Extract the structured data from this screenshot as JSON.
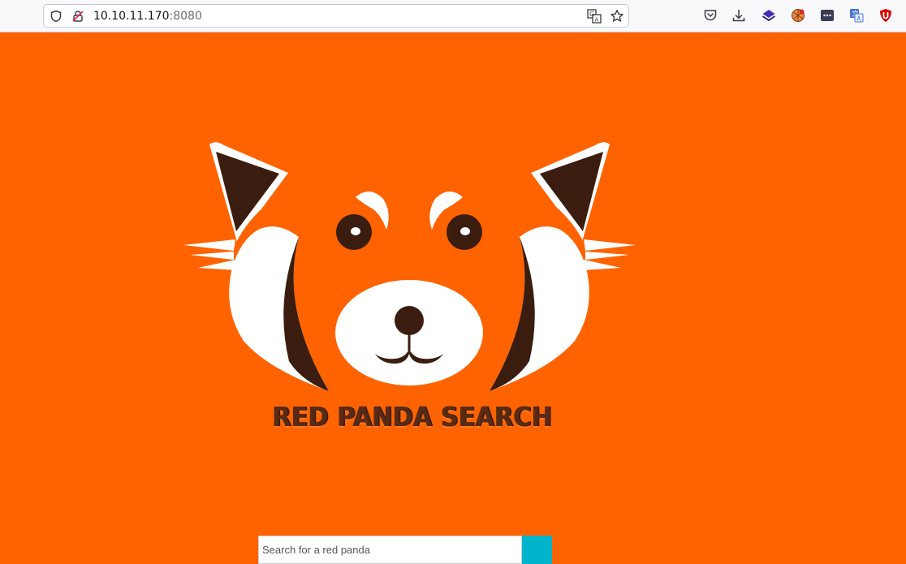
{
  "browser": {
    "url_host": "10.10.11.170",
    "url_port": ":8080",
    "icons": [
      "shield-icon",
      "insecure-lock-icon",
      "translate-icon",
      "bookmark-star-icon",
      "pocket-icon",
      "download-icon",
      "extension-layers-icon",
      "extension-ball-icon",
      "extension-menu-icon",
      "extension-translate-icon",
      "ublock-icon"
    ]
  },
  "page": {
    "brand_title": "RED PANDA SEARCH",
    "search": {
      "placeholder": "Search for a red panda",
      "value": ""
    },
    "colors": {
      "background": "#ff6300",
      "button": "#00b4cc",
      "dark_brown": "#3b1d10"
    }
  }
}
